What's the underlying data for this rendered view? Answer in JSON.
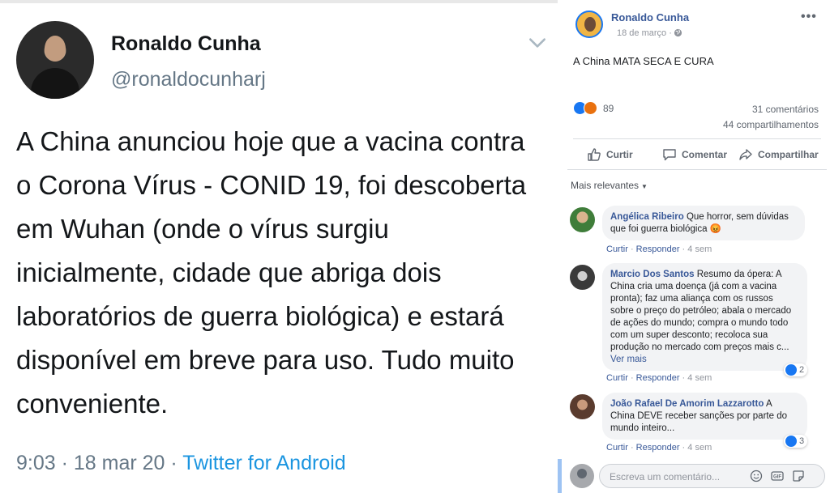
{
  "tweet": {
    "name": "Ronaldo Cunha",
    "handle": "@ronaldocunharj",
    "text": "A China anunciou hoje que a vacina contra o Corona Vírus - CONID 19, foi descoberta em Wuhan (onde o vírus surgiu inicialmente, cidade que abriga dois laboratórios de guerra biológica) e estará disponível em breve para uso. Tudo muito conveniente.",
    "time": "9:03 · 18 mar 20 · ",
    "source": "Twitter for Android",
    "icons": {
      "menu": "chevron-down-icon",
      "avatar": "profile-photo"
    }
  },
  "facebook_post": {
    "author": "Ronaldo Cunha",
    "date": "18 de março ·",
    "text": "A China MATA SECA E CURA",
    "reaction_count": "89",
    "comments_count": "31 comentários",
    "shares_count": "44 compartilhamentos",
    "actions": [
      "Curtir",
      "Comentar",
      "Compartilhar"
    ],
    "sort_label": "Mais relevantes",
    "comments": [
      {
        "author": "Angélica Ribeiro",
        "text": "Que horror, sem dúvidas que foi guerra biológica 😡",
        "like": "Curtir",
        "reply": "Responder",
        "age": "4 sem",
        "reactions": ""
      },
      {
        "author": "Marcio Dos Santos",
        "text": "Resumo da ópera: A China cria uma doença (já com a vacina pronta); faz uma aliança com os russos sobre o preço do petróleo; abala o mercado de ações do mundo; compra o mundo todo com um super desconto; recoloca sua produção no mercado com preços mais c...",
        "more": "Ver mais",
        "like": "Curtir",
        "reply": "Responder",
        "age": "4 sem",
        "reactions": "2"
      },
      {
        "author": "João Rafael De Amorim Lazzarotto",
        "text": "A China DEVE receber sanções por parte do mundo inteiro...",
        "like": "Curtir",
        "reply": "Responder",
        "age": "4 sem",
        "reactions": "3"
      }
    ],
    "comment_placeholder": "Escreva um comentário...",
    "colors": {
      "link": "#385898",
      "like": "#1877f2",
      "angry": "#e9710f"
    }
  }
}
